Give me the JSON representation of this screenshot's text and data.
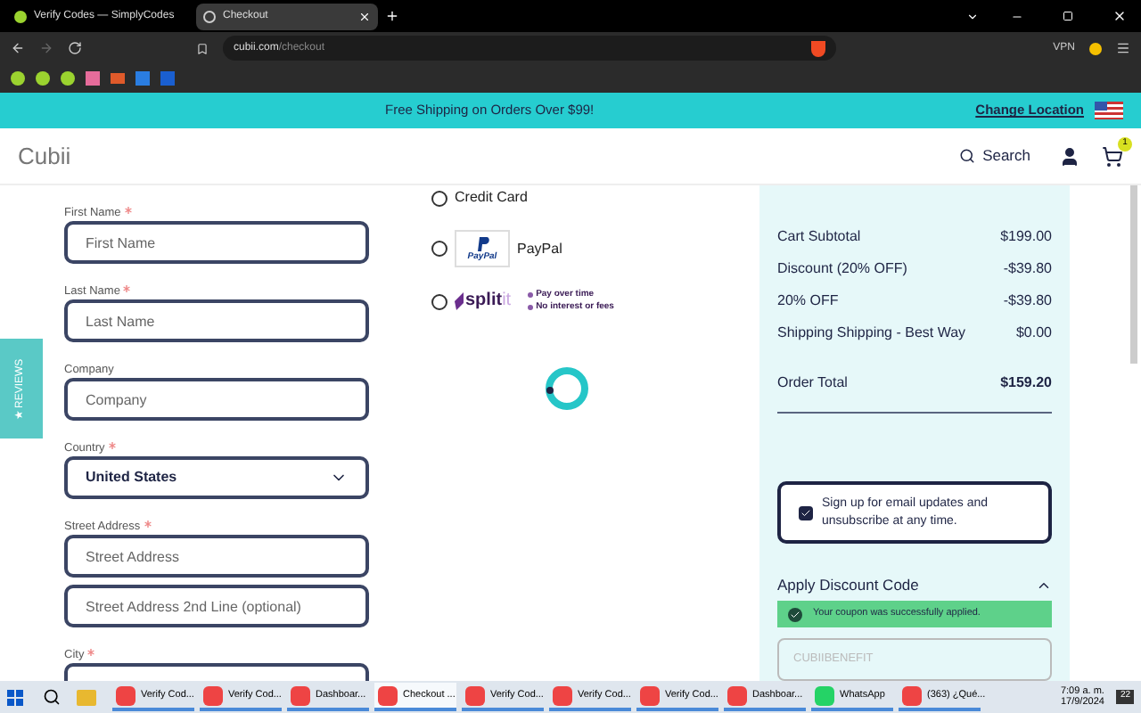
{
  "browser": {
    "tabs": [
      {
        "title": "Verify Codes — SimplyCodes",
        "selected": false
      },
      {
        "title": "Checkout",
        "selected": true
      }
    ],
    "url_host": "cubii.com",
    "url_path": "/checkout",
    "vpn": "VPN"
  },
  "banner": {
    "text": "Free Shipping on Orders Over $99!",
    "link": "Change Location"
  },
  "header": {
    "logo": "Cubii",
    "search": "Search",
    "cart_count": "1"
  },
  "reviews_tab": "★ REVIEWS",
  "form": [
    {
      "label": "First Name",
      "required": true,
      "kind": "input",
      "placeholder": "First Name"
    },
    {
      "label": "Last Name",
      "required": true,
      "kind": "input",
      "placeholder": "Last Name"
    },
    {
      "label": "Company",
      "required": false,
      "kind": "input",
      "placeholder": "Company"
    },
    {
      "label": "Country",
      "required": true,
      "kind": "select",
      "value": "United States"
    },
    {
      "label": "Street Address",
      "required": true,
      "kind": "input",
      "placeholder": "Street Address"
    },
    {
      "kind": "input",
      "placeholder": "Street Address 2nd Line (optional)"
    },
    {
      "label": "City",
      "required": true,
      "kind": "input"
    }
  ],
  "payment": [
    {
      "kind": "card",
      "label": "Credit Card",
      "selected": false
    },
    {
      "kind": "paypal",
      "label": "PayPal",
      "logo_text": "PayPal",
      "selected": false
    },
    {
      "kind": "splitit",
      "logo": "split",
      "logo_tail": "it",
      "bullets": [
        "Pay over time",
        "No interest or fees"
      ],
      "selected": false
    }
  ],
  "summary": {
    "rows": [
      {
        "label": "Cart Subtotal",
        "value": "$199.00"
      },
      {
        "label": "Discount (20% OFF)",
        "value": "-$39.80"
      },
      {
        "label": "20% OFF",
        "value": "-$39.80"
      },
      {
        "label": "Shipping Shipping - Best Way",
        "value": "$0.00"
      }
    ],
    "total_label": "Order Total",
    "total_value": "$159.20",
    "newsletter": {
      "text": "Sign up for email updates and unsubscribe at any time.",
      "checked": true
    },
    "discount": {
      "title": "Apply Discount Code",
      "expanded": true,
      "message": "Your coupon was successfully applied.",
      "code": "CUBIIBENEFIT"
    }
  },
  "taskbar": {
    "items": [
      {
        "label": "Verify Cod...",
        "selected": false
      },
      {
        "label": "Verify Cod...",
        "selected": false
      },
      {
        "label": "Dashboar...",
        "selected": false
      },
      {
        "label": "Checkout ...",
        "selected": true
      },
      {
        "label": "Verify Cod...",
        "selected": false
      },
      {
        "label": "Verify Cod...",
        "selected": false
      },
      {
        "label": "Verify Cod...",
        "selected": false
      },
      {
        "label": "Dashboar...",
        "selected": false
      },
      {
        "label": "WhatsApp",
        "selected": false
      },
      {
        "label": "(363) ¿Qué...",
        "selected": false
      }
    ],
    "time": "7:09 a. m.",
    "date": "17/9/2024",
    "badge": "22"
  }
}
